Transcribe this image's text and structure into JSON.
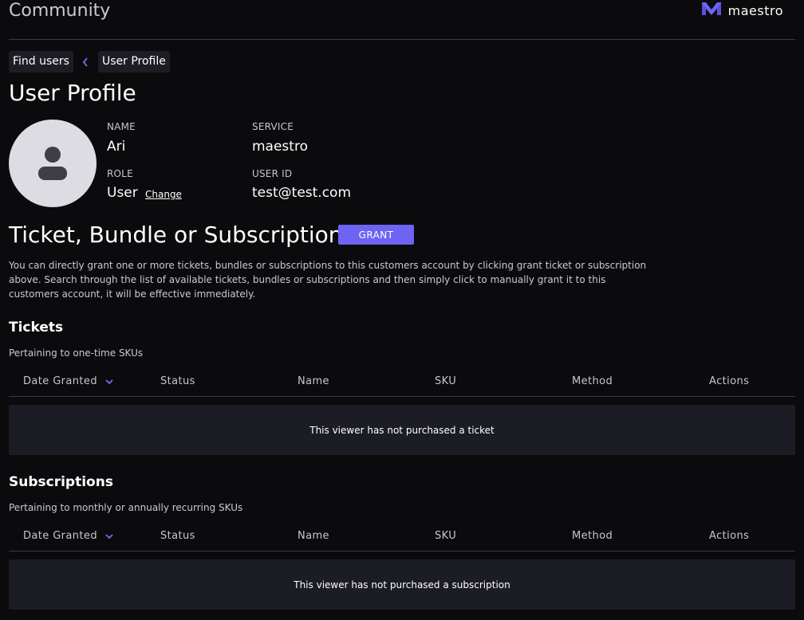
{
  "header": {
    "title": "Community",
    "brand": "maestro",
    "brand_color": "#6e63f2"
  },
  "breadcrumb": {
    "items": [
      "Find users",
      "User Profile"
    ],
    "separator_icon": "chevron-left-icon"
  },
  "page": {
    "title": "User Profile"
  },
  "profile": {
    "avatar_icon": "user-silhouette-icon",
    "name_label": "NAME",
    "name": "Ari",
    "role_label": "ROLE",
    "role": "User",
    "change_label": "Change",
    "service_label": "SERVICE",
    "service": "maestro",
    "user_id_label": "USER ID",
    "user_id": "test@test.com"
  },
  "grant_section": {
    "title": "Ticket, Bundle or Subscription",
    "button_label": "GRANT",
    "description": "You can directly grant one or more tickets, bundles or subscriptions to this customers account by clicking grant ticket or subscription above. Search through the list of available tickets, bundles or subscriptions and then simply click to manually grant it to this customers account, it will be effective immediately."
  },
  "tickets": {
    "title": "Tickets",
    "subtitle": "Pertaining to one-time SKUs",
    "columns": [
      "Date Granted",
      "Status",
      "Name",
      "SKU",
      "Method",
      "Actions"
    ],
    "empty_message": "This viewer has not purchased a ticket"
  },
  "subscriptions": {
    "title": "Subscriptions",
    "subtitle": "Pertaining to monthly or annually recurring SKUs",
    "columns": [
      "Date Granted",
      "Status",
      "Name",
      "SKU",
      "Method",
      "Actions"
    ],
    "empty_message": "This viewer has not purchased a subscription"
  },
  "colors": {
    "background": "#0b0b0e",
    "accent": "#6e63f2",
    "panel": "#1b1c24",
    "divider": "#3a3a42"
  }
}
